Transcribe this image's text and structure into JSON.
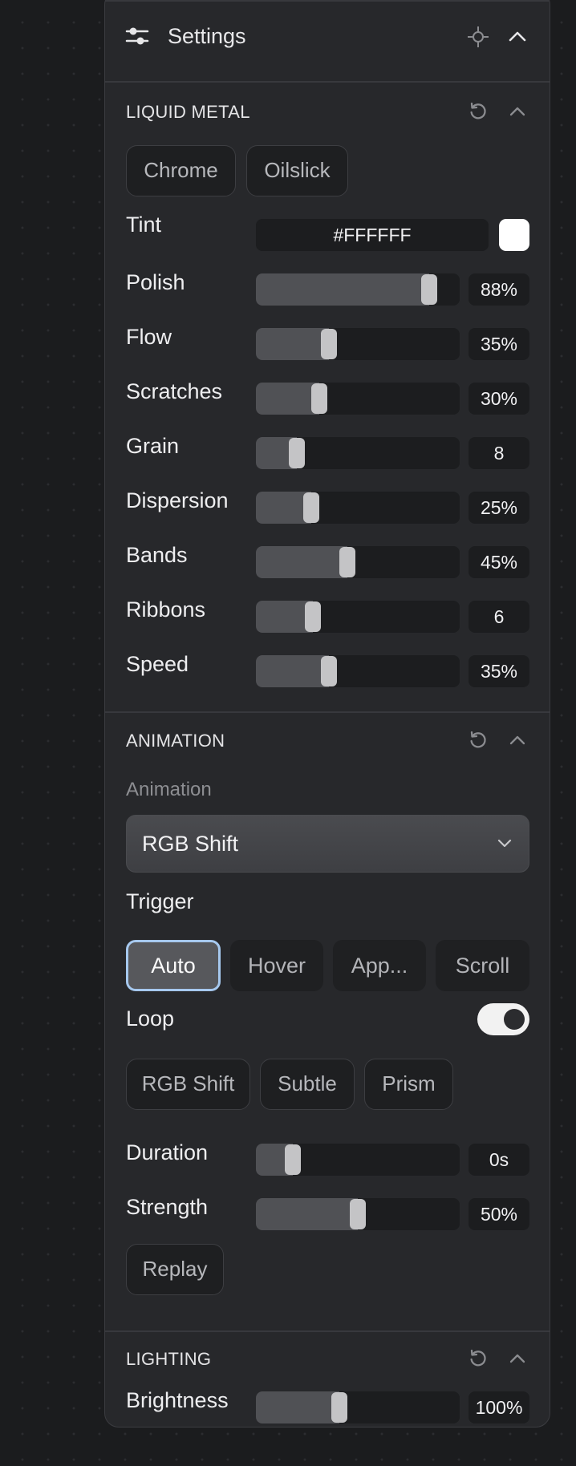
{
  "header": {
    "title": "Settings"
  },
  "liquid_metal": {
    "title": "LIQUID METAL",
    "presets": [
      "Chrome",
      "Oilslick"
    ],
    "tint": {
      "label": "Tint",
      "value": "#FFFFFF",
      "swatch_color": "#FFFFFF"
    },
    "sliders": [
      {
        "label": "Polish",
        "value": "88%",
        "fraction": 0.85
      },
      {
        "label": "Flow",
        "value": "35%",
        "fraction": 0.36
      },
      {
        "label": "Scratches",
        "value": "30%",
        "fraction": 0.31
      },
      {
        "label": "Grain",
        "value": "8",
        "fraction": 0.2
      },
      {
        "label": "Dispersion",
        "value": "25%",
        "fraction": 0.27
      },
      {
        "label": "Bands",
        "value": "45%",
        "fraction": 0.45
      },
      {
        "label": "Ribbons",
        "value": "6",
        "fraction": 0.28
      },
      {
        "label": "Speed",
        "value": "35%",
        "fraction": 0.36
      }
    ]
  },
  "animation": {
    "title": "ANIMATION",
    "select_label": "Animation",
    "select_value": "RGB Shift",
    "trigger_label": "Trigger",
    "triggers": [
      "Auto",
      "Hover",
      "App...",
      "Scroll"
    ],
    "active_trigger": "Auto",
    "loop_label": "Loop",
    "loop_on": true,
    "presets": [
      "RGB Shift",
      "Subtle",
      "Prism"
    ],
    "sliders": [
      {
        "label": "Duration",
        "value": "0s",
        "fraction": 0.18
      },
      {
        "label": "Strength",
        "value": "50%",
        "fraction": 0.5
      }
    ],
    "replay_label": "Replay"
  },
  "lighting": {
    "title": "LIGHTING",
    "sliders": [
      {
        "label": "Brightness",
        "value": "100%",
        "fraction": 0.41
      }
    ]
  },
  "colors": {
    "panel": "#27282B",
    "focus_ring": "#A6C8EE",
    "thumb": "#C4C4C6"
  }
}
